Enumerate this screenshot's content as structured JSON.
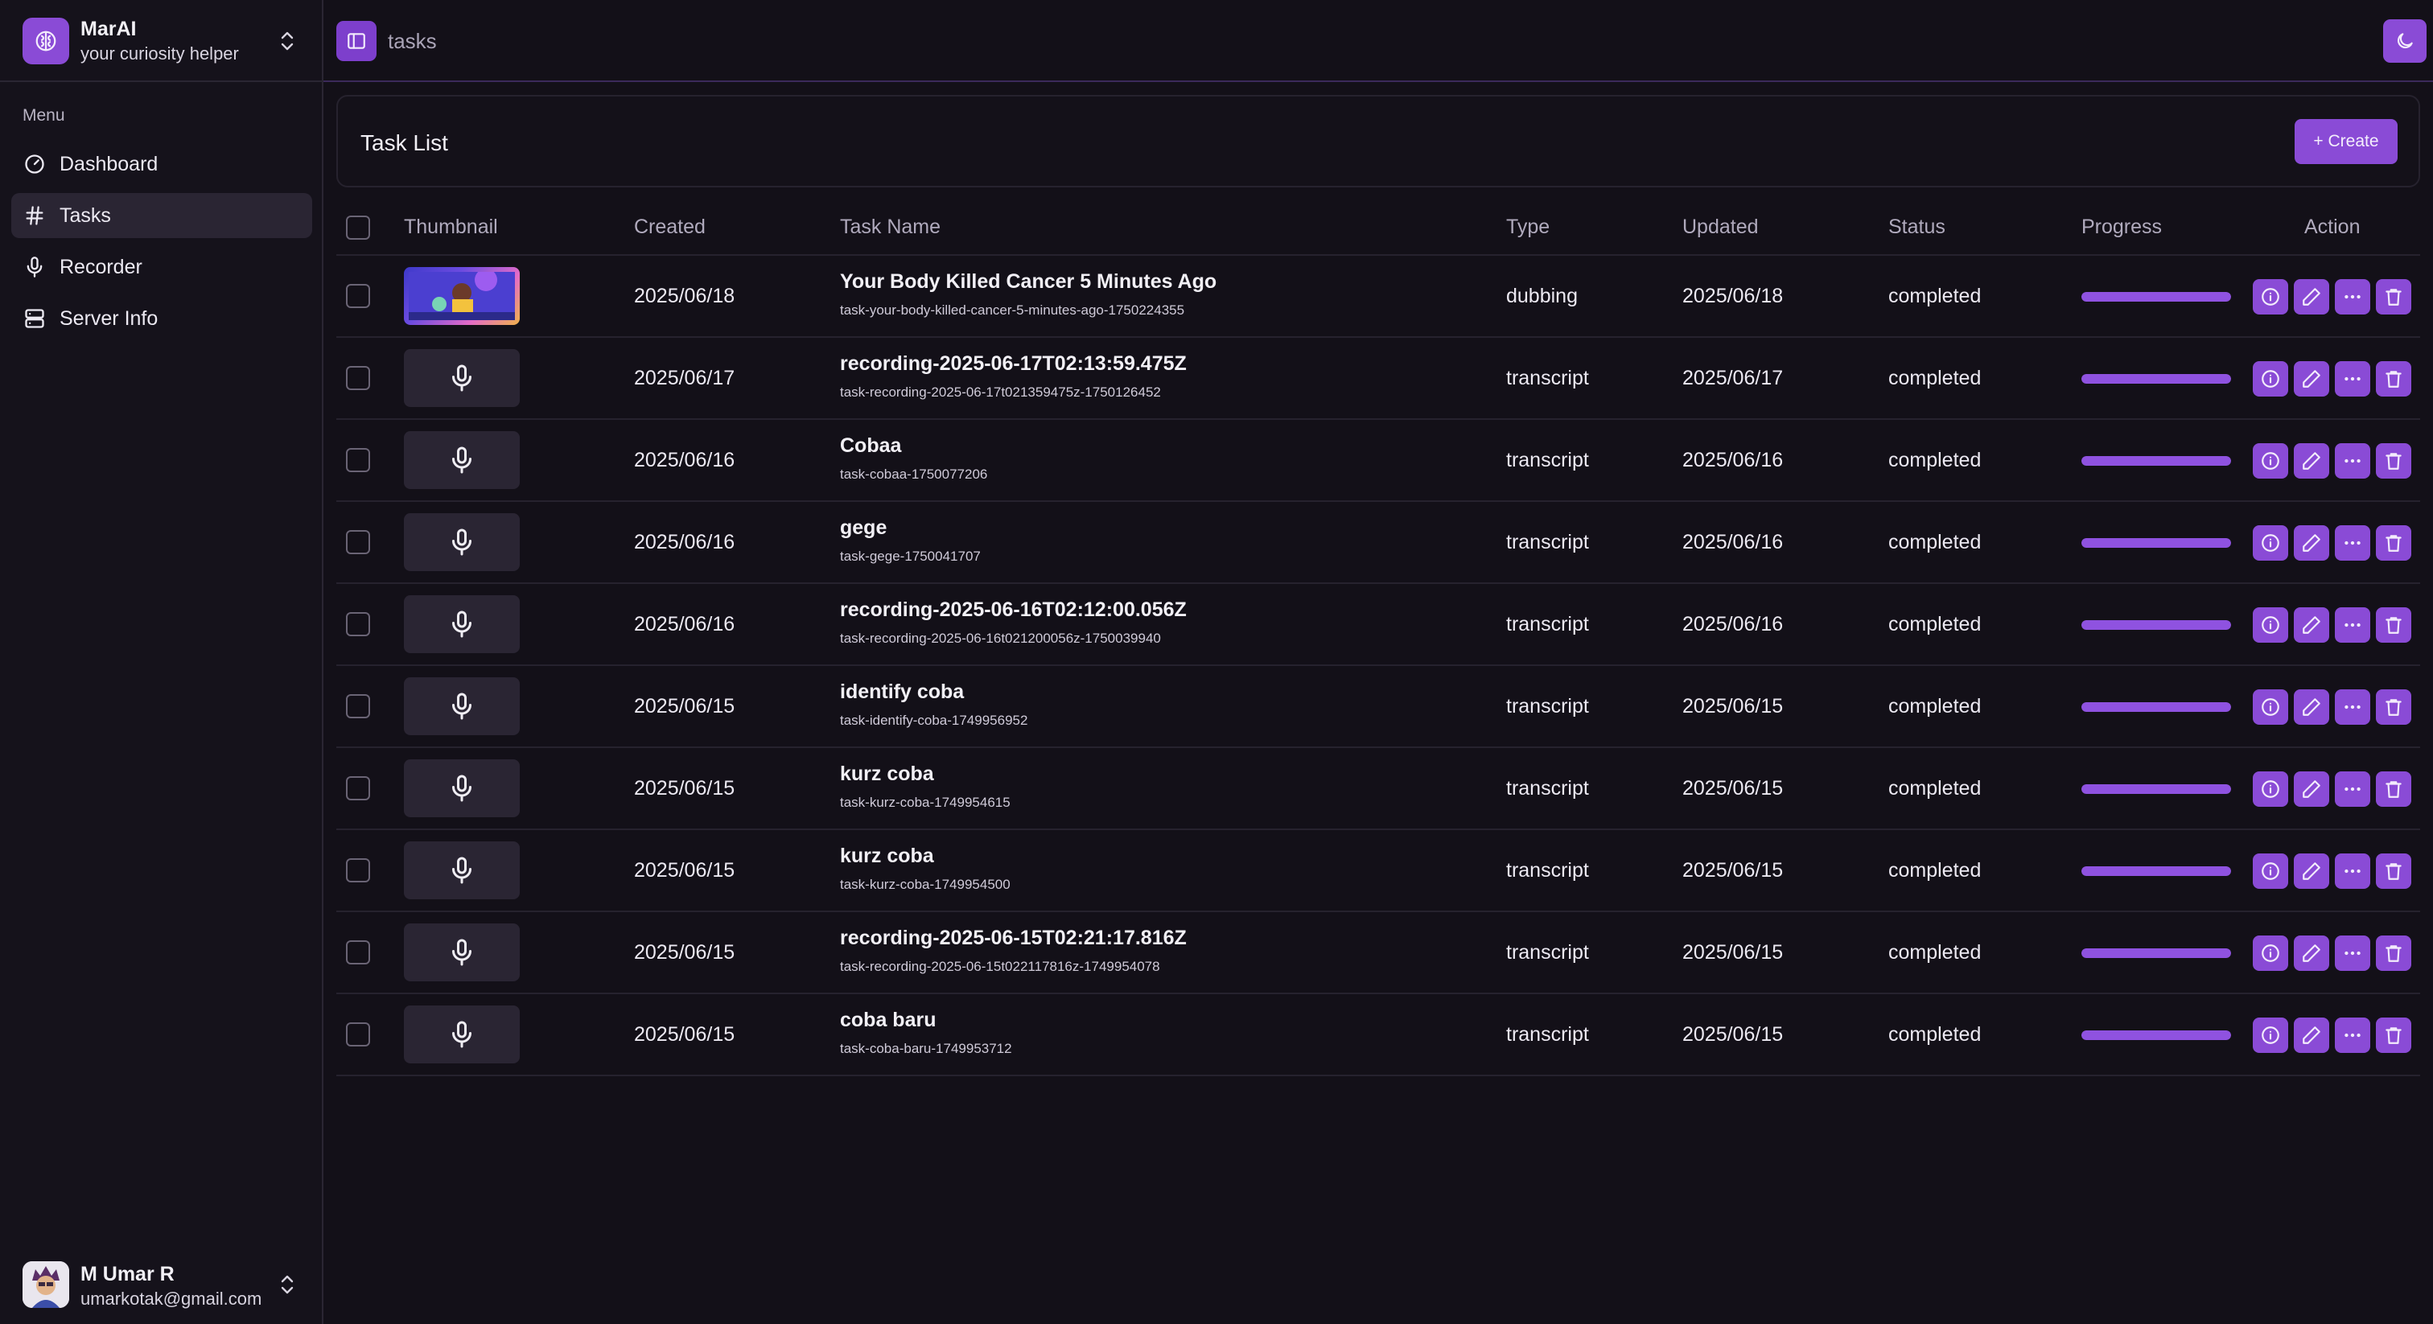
{
  "brand": {
    "name": "MarAI",
    "subtitle": "your curiosity helper"
  },
  "sidebar": {
    "menu_label": "Menu",
    "items": [
      {
        "label": "Dashboard",
        "icon": "gauge-icon",
        "active": false
      },
      {
        "label": "Tasks",
        "icon": "hash-icon",
        "active": true
      },
      {
        "label": "Recorder",
        "icon": "microphone-icon",
        "active": false
      },
      {
        "label": "Server Info",
        "icon": "server-icon",
        "active": false
      }
    ]
  },
  "user": {
    "name": "M Umar R",
    "email": "umarkotak@gmail.com"
  },
  "header": {
    "breadcrumb": "tasks"
  },
  "card": {
    "title": "Task List",
    "create_label": "+ Create"
  },
  "table": {
    "columns": [
      "Thumbnail",
      "Created",
      "Task Name",
      "Type",
      "Updated",
      "Status",
      "Progress",
      "Action"
    ],
    "rows": [
      {
        "thumb": "image",
        "created": "2025/06/18",
        "name": "Your Body Killed Cancer 5 Minutes Ago",
        "slug": "task-your-body-killed-cancer-5-minutes-ago-1750224355",
        "type": "dubbing",
        "updated": "2025/06/18",
        "status": "completed",
        "progress": 100
      },
      {
        "thumb": "mic",
        "created": "2025/06/17",
        "name": "recording-2025-06-17T02:13:59.475Z",
        "slug": "task-recording-2025-06-17t021359475z-1750126452",
        "type": "transcript",
        "updated": "2025/06/17",
        "status": "completed",
        "progress": 100
      },
      {
        "thumb": "mic",
        "created": "2025/06/16",
        "name": "Cobaa",
        "slug": "task-cobaa-1750077206",
        "type": "transcript",
        "updated": "2025/06/16",
        "status": "completed",
        "progress": 100
      },
      {
        "thumb": "mic",
        "created": "2025/06/16",
        "name": "gege",
        "slug": "task-gege-1750041707",
        "type": "transcript",
        "updated": "2025/06/16",
        "status": "completed",
        "progress": 100
      },
      {
        "thumb": "mic",
        "created": "2025/06/16",
        "name": "recording-2025-06-16T02:12:00.056Z",
        "slug": "task-recording-2025-06-16t021200056z-1750039940",
        "type": "transcript",
        "updated": "2025/06/16",
        "status": "completed",
        "progress": 100
      },
      {
        "thumb": "mic",
        "created": "2025/06/15",
        "name": "identify coba",
        "slug": "task-identify-coba-1749956952",
        "type": "transcript",
        "updated": "2025/06/15",
        "status": "completed",
        "progress": 100
      },
      {
        "thumb": "mic",
        "created": "2025/06/15",
        "name": "kurz coba",
        "slug": "task-kurz-coba-1749954615",
        "type": "transcript",
        "updated": "2025/06/15",
        "status": "completed",
        "progress": 100
      },
      {
        "thumb": "mic",
        "created": "2025/06/15",
        "name": "kurz coba",
        "slug": "task-kurz-coba-1749954500",
        "type": "transcript",
        "updated": "2025/06/15",
        "status": "completed",
        "progress": 100
      },
      {
        "thumb": "mic",
        "created": "2025/06/15",
        "name": "recording-2025-06-15T02:21:17.816Z",
        "slug": "task-recording-2025-06-15t022117816z-1749954078",
        "type": "transcript",
        "updated": "2025/06/15",
        "status": "completed",
        "progress": 100
      },
      {
        "thumb": "mic",
        "created": "2025/06/15",
        "name": "coba baru",
        "slug": "task-coba-baru-1749953712",
        "type": "transcript",
        "updated": "2025/06/15",
        "status": "completed",
        "progress": 100
      }
    ]
  },
  "colors": {
    "accent": "#8a4bd6",
    "background": "#131018",
    "sidebar": "#15121b"
  }
}
